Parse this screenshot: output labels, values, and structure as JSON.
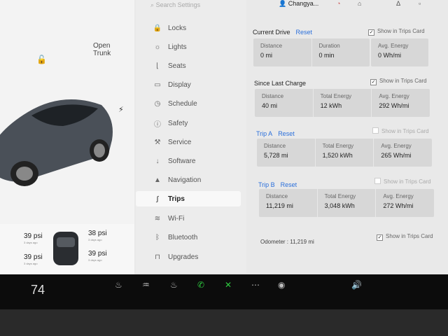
{
  "search": {
    "placeholder": "Search Settings"
  },
  "user": {
    "name": "Changya..."
  },
  "car": {
    "open_trunk": [
      "Open",
      "Trunk"
    ]
  },
  "tires": [
    {
      "psi": "39 psi",
      "sub": "3 days ago"
    },
    {
      "psi": "38 psi",
      "sub": "3 days ago"
    },
    {
      "psi": "39 psi",
      "sub": "3 days ago"
    },
    {
      "psi": "39 psi",
      "sub": "3 days ago"
    }
  ],
  "nav": {
    "items": [
      {
        "label": "Locks",
        "icon": "lock-icon"
      },
      {
        "label": "Lights",
        "icon": "sun-icon"
      },
      {
        "label": "Seats",
        "icon": "seat-icon"
      },
      {
        "label": "Display",
        "icon": "display-icon"
      },
      {
        "label": "Schedule",
        "icon": "clock-icon"
      },
      {
        "label": "Safety",
        "icon": "info-icon"
      },
      {
        "label": "Service",
        "icon": "wrench-icon"
      },
      {
        "label": "Software",
        "icon": "download-icon"
      },
      {
        "label": "Navigation",
        "icon": "navigation-icon"
      },
      {
        "label": "Trips",
        "icon": "trips-icon"
      },
      {
        "label": "Wi-Fi",
        "icon": "wifi-icon"
      },
      {
        "label": "Bluetooth",
        "icon": "bluetooth-icon"
      },
      {
        "label": "Upgrades",
        "icon": "bag-icon"
      }
    ]
  },
  "trips": {
    "reset_label": "Reset",
    "show_in_card": "Show in Trips Card",
    "current_drive": {
      "title": "Current Drive",
      "distance_label": "Distance",
      "distance": "0 mi",
      "duration_label": "Duration",
      "duration": "0 min",
      "energy_label": "Avg. Energy",
      "energy": "0 Wh/mi"
    },
    "since_last_charge": {
      "title": "Since Last Charge",
      "distance_label": "Distance",
      "distance": "40 mi",
      "total_label": "Total Energy",
      "total": "12 kWh",
      "energy_label": "Avg. Energy",
      "energy": "292 Wh/mi"
    },
    "trip_a": {
      "title": "Trip A",
      "distance_label": "Distance",
      "distance": "5,728 mi",
      "total_label": "Total Energy",
      "total": "1,520 kWh",
      "energy_label": "Avg. Energy",
      "energy": "265 Wh/mi"
    },
    "trip_b": {
      "title": "Trip B",
      "distance_label": "Distance",
      "distance": "11,219 mi",
      "total_label": "Total Energy",
      "total": "3,048 kWh",
      "energy_label": "Avg. Energy",
      "energy": "272 Wh/mi"
    },
    "odometer": {
      "label": "Odometer :",
      "value": "11,219 mi"
    }
  },
  "bottom": {
    "temperature": "74"
  }
}
